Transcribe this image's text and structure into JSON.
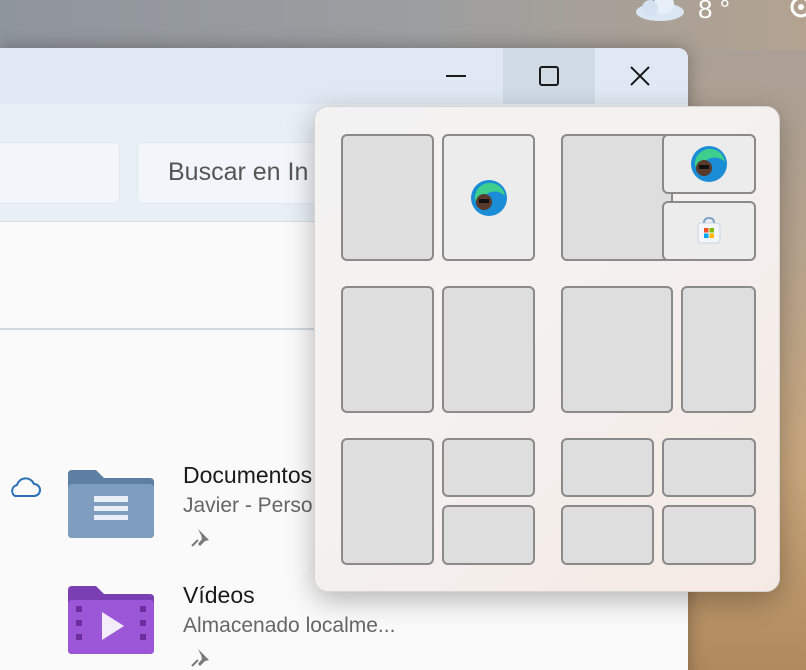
{
  "desktop": {
    "weather_icon": "cloud-icon",
    "temperature": "8 °"
  },
  "window": {
    "controls": {
      "minimize_icon": "minimize-icon",
      "maximize_icon": "maximize-icon",
      "close_icon": "close-icon"
    },
    "search": {
      "placeholder": "Buscar en In"
    }
  },
  "files": [
    {
      "name": "Documentos",
      "subtitle": "Javier - Perso",
      "icon": "documents-folder-icon",
      "cloud": true
    },
    {
      "name": "Vídeos",
      "subtitle": "Almacenado localme...",
      "icon": "videos-folder-icon",
      "cloud": false
    }
  ],
  "snap_layouts": {
    "apps": [
      "edge",
      "microsoft-store"
    ],
    "colors": {
      "zone_fill": "#dedede",
      "zone_border": "#8a8a8a"
    }
  }
}
